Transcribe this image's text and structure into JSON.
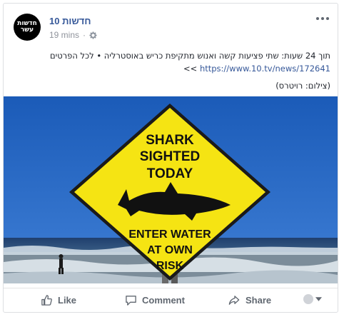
{
  "post": {
    "page_name": "חדשות 10",
    "avatar_text_line1": "חדשות",
    "avatar_text_line2": "עשר",
    "time": "19 mins",
    "privacy_icon": "gear-icon",
    "text_line1": "תוך 24 שעות: שתי פציעות קשה ואנוש מתקיפת כריש באוסטרליה • לכל הפרטים",
    "link_prefix": ">>",
    "link": "https://www.10.tv/news/172641",
    "credit": "(צילום: רויטרס)"
  },
  "sign": {
    "line1": "SHARK",
    "line2": "SIGHTED",
    "line3": "TODAY",
    "line4": "ENTER WATER",
    "line5": "AT OWN",
    "line6": "RISK"
  },
  "actions": {
    "like": "Like",
    "comment": "Comment",
    "share": "Share"
  },
  "colors": {
    "link": "#365899",
    "sign_yellow": "#f5e413",
    "sky": "#1f5fbd"
  }
}
